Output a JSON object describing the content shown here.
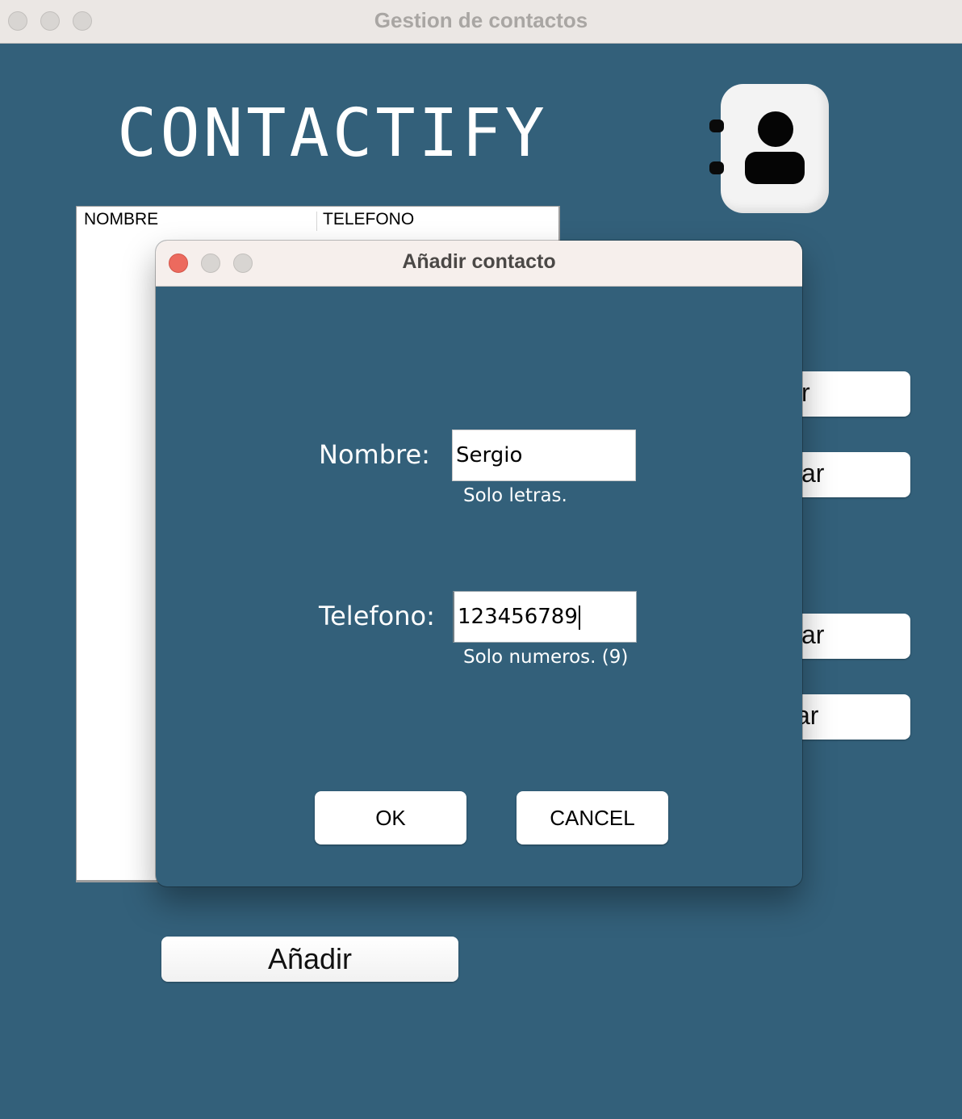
{
  "window": {
    "title": "Gestion de contactos"
  },
  "app": {
    "title": "CONTACTIFY",
    "logo_icon": "address-book-icon"
  },
  "table": {
    "columns": [
      "NOMBRE",
      "TELEFONO"
    ],
    "rows": []
  },
  "side_buttons": [
    "r",
    "ar",
    "ar",
    "ar"
  ],
  "add_button": {
    "label": "Añadir"
  },
  "dialog": {
    "title": "Añadir contacto",
    "nombre": {
      "label": "Nombre:",
      "value": "Sergio",
      "hint": "Solo letras."
    },
    "telefono": {
      "label": "Telefono:",
      "value": "123456789",
      "hint": "Solo numeros. (9)"
    },
    "ok_label": "OK",
    "cancel_label": "CANCEL"
  },
  "colors": {
    "background": "#33607a",
    "close_button": "#ec6a5e",
    "titlebar": "#ebe7e4"
  }
}
